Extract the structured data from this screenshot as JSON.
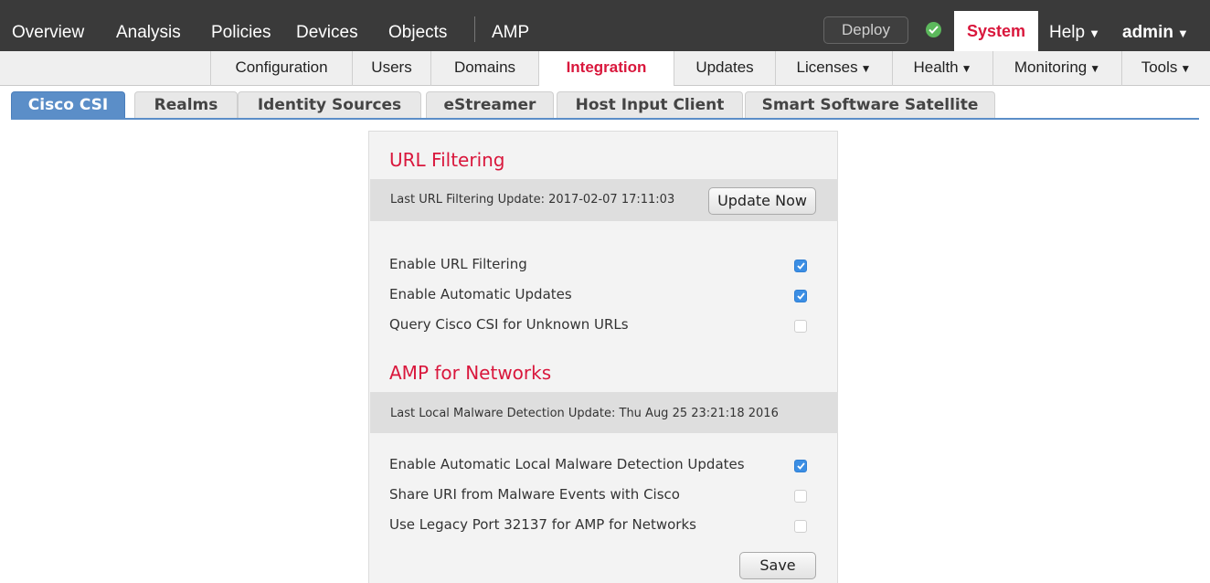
{
  "topnav": {
    "items": [
      "Overview",
      "Analysis",
      "Policies",
      "Devices",
      "Objects",
      "AMP"
    ],
    "deploy_label": "Deploy",
    "system_label": "System",
    "help_label": "Help",
    "user_label": "admin",
    "dropdown_glyph": "▼",
    "status_icon": "check-circle-icon",
    "status_color": "#5cb85c"
  },
  "subnav": {
    "items": [
      "Configuration",
      "Users",
      "Domains",
      "Integration",
      "Updates",
      "Licenses",
      "Health",
      "Monitoring",
      "Tools"
    ],
    "active": "Integration",
    "dropdown_glyph": "▼"
  },
  "tabs": {
    "items": [
      "Cisco CSI",
      "Realms",
      "Identity Sources",
      "eStreamer",
      "Host Input Client",
      "Smart Software Satellite"
    ],
    "active": "Cisco CSI"
  },
  "url_filtering": {
    "title": "URL Filtering",
    "last_update": "Last URL Filtering Update: 2017-02-07 17:11:03",
    "update_button": "Update Now",
    "options": [
      {
        "label": "Enable URL Filtering",
        "checked": true
      },
      {
        "label": "Enable Automatic Updates",
        "checked": true
      },
      {
        "label": "Query Cisco CSI for Unknown URLs",
        "checked": false
      }
    ]
  },
  "amp": {
    "title": "AMP for Networks",
    "last_update": "Last Local Malware Detection Update: Thu Aug 25 23:21:18 2016",
    "options": [
      {
        "label": "Enable Automatic Local Malware Detection Updates",
        "checked": true
      },
      {
        "label": "Share URI from Malware Events with Cisco",
        "checked": false
      },
      {
        "label": "Use Legacy Port 32137 for AMP for Networks",
        "checked": false
      }
    ]
  },
  "save_label": "Save",
  "colors": {
    "accent": "#d9173c",
    "tab_active": "#5b8ec8",
    "checkbox_checked": "#3b8ee4",
    "nav_bg": "#3a3a3a"
  }
}
